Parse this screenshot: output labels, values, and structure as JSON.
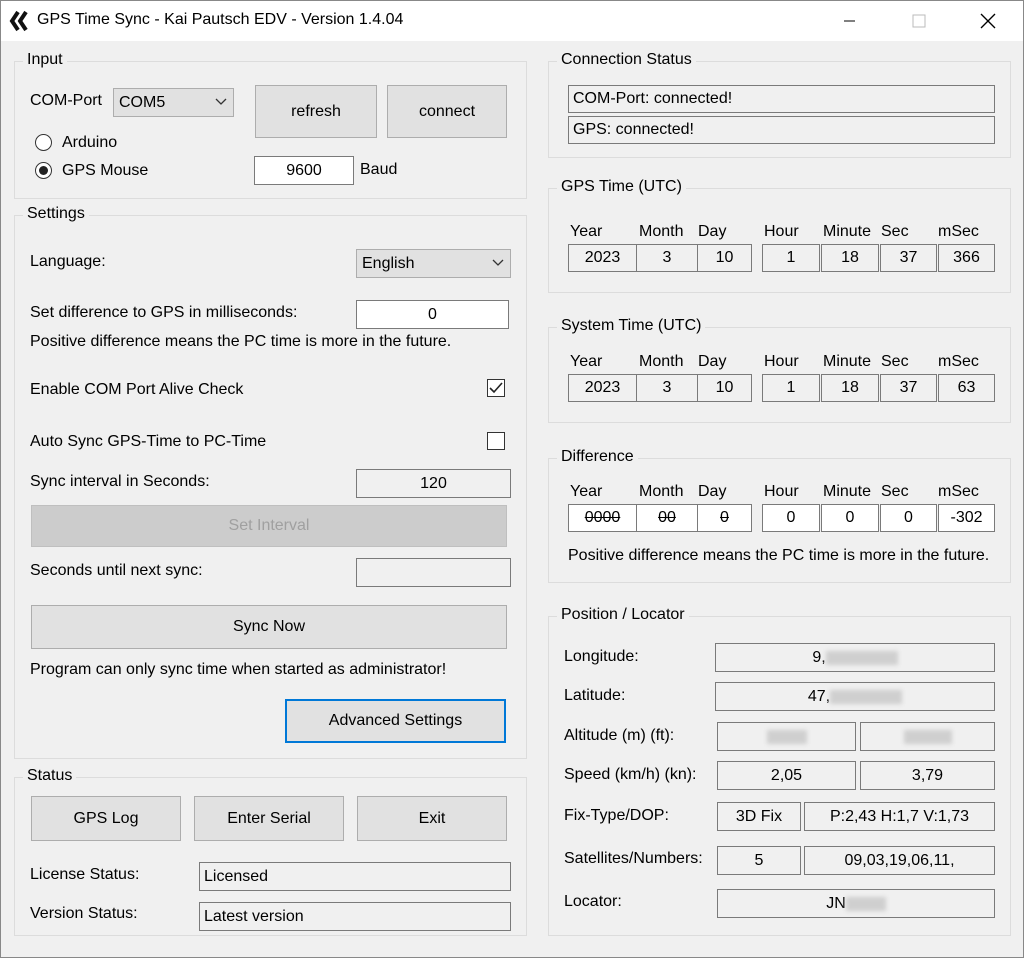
{
  "window": {
    "title": "GPS Time Sync - Kai Pautsch EDV - Version 1.4.04"
  },
  "input": {
    "group_title": "Input",
    "com_port_label": "COM-Port",
    "com_port_value": "COM5",
    "refresh_label": "refresh",
    "connect_label": "connect",
    "radio_arduino": "Arduino",
    "radio_gps_mouse": "GPS Mouse",
    "baud_value": "9600",
    "baud_label": "Baud"
  },
  "settings": {
    "group_title": "Settings",
    "language_label": "Language:",
    "language_value": "English",
    "difference_label": "Set difference to GPS in milliseconds:",
    "difference_value": "0",
    "difference_note": "Positive difference means the PC time is more in the future.",
    "alive_check_label": "Enable COM Port Alive Check",
    "alive_check_checked": true,
    "auto_sync_label": "Auto Sync GPS-Time to PC-Time",
    "auto_sync_checked": false,
    "sync_interval_label": "Sync interval in Seconds:",
    "sync_interval_value": "120",
    "set_interval_label": "Set Interval",
    "seconds_next_label": "Seconds until next sync:",
    "seconds_next_value": "",
    "sync_now_label": "Sync Now",
    "admin_note": "Program can only sync time when started as administrator!",
    "advanced_label": "Advanced Settings"
  },
  "status": {
    "group_title": "Status",
    "gps_log_label": "GPS Log",
    "enter_serial_label": "Enter Serial",
    "exit_label": "Exit",
    "license_label": "License Status:",
    "license_value": "Licensed",
    "version_label": "Version Status:",
    "version_value": "Latest version"
  },
  "connection": {
    "group_title": "Connection Status",
    "com_status": "COM-Port: connected!",
    "gps_status": "GPS: connected!"
  },
  "time_headers": {
    "year": "Year",
    "month": "Month",
    "day": "Day",
    "hour": "Hour",
    "minute": "Minute",
    "sec": "Sec",
    "msec": "mSec"
  },
  "gps_time": {
    "group_title": "GPS Time (UTC)",
    "year": "2023",
    "month": "3",
    "day": "10",
    "hour": "1",
    "minute": "18",
    "sec": "37",
    "msec": "366"
  },
  "system_time": {
    "group_title": "System Time (UTC)",
    "year": "2023",
    "month": "3",
    "day": "10",
    "hour": "1",
    "minute": "18",
    "sec": "37",
    "msec": "63"
  },
  "difference": {
    "group_title": "Difference",
    "year": "0000",
    "month": "00",
    "day": "0",
    "hour": "0",
    "minute": "0",
    "sec": "0",
    "msec": "-302",
    "note": "Positive difference means the PC time is more in the future."
  },
  "position": {
    "group_title": "Position / Locator",
    "longitude_label": "Longitude:",
    "longitude_value": "9,",
    "latitude_label": "Latitude:",
    "latitude_value": "47,",
    "altitude_label": "Altitude (m) (ft):",
    "speed_label": "Speed (km/h) (kn):",
    "speed_kmh": "2,05",
    "speed_kn": "3,79",
    "fix_label": "Fix-Type/DOP:",
    "fix_type": "3D Fix",
    "dop": "P:2,43 H:1,7 V:1,73",
    "sat_label": "Satellites/Numbers:",
    "sat_count": "5",
    "sat_numbers": "09,03,19,06,11,",
    "locator_label": "Locator:",
    "locator_value": "JN"
  }
}
